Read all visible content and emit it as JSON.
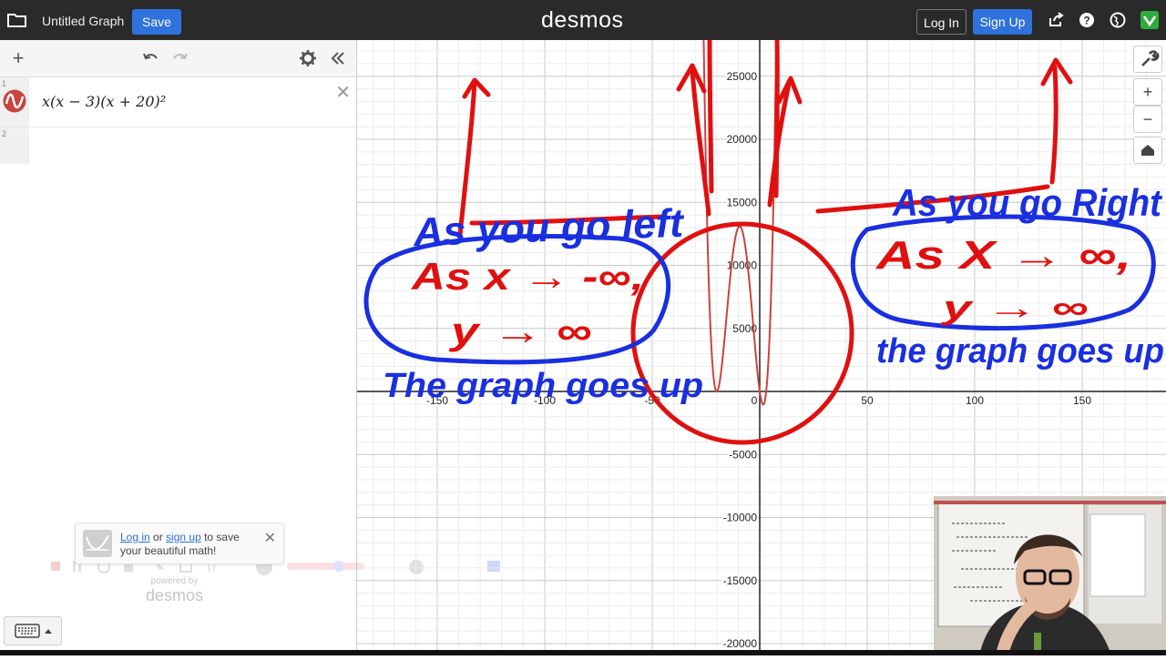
{
  "header": {
    "title": "Untitled Graph",
    "save_label": "Save",
    "brand": "desmos",
    "login_label": "Log In",
    "signup_label": "Sign Up",
    "icons": [
      "folder-icon",
      "share-icon",
      "help-icon",
      "globe-icon",
      "avatar-icon"
    ]
  },
  "expressions": [
    {
      "index": "1",
      "latex": "x(x − 3)(x + 20)²",
      "color": "#c74440"
    },
    {
      "index": "2",
      "latex": ""
    }
  ],
  "toast": {
    "login_link": "Log in",
    "or_text": " or ",
    "signup_link": "sign up",
    "message": " to save your beautiful math!"
  },
  "powered": {
    "label": "powered by",
    "brand": "desmos"
  },
  "graph": {
    "x_ticks": [
      "-150",
      "-100",
      "-50",
      "0",
      "50",
      "100",
      "150"
    ],
    "y_ticks": [
      "25000",
      "20000",
      "15000",
      "10000",
      "5000",
      "-5000",
      "-10000",
      "-15000",
      "-20000"
    ],
    "curve_color": "#c74440"
  },
  "annotations": {
    "left_heading": "As you go left",
    "left_limit_x": "As x → -∞,",
    "left_limit_y": "y → ∞",
    "left_caption": "The graph goes up",
    "right_heading": "As you go Right",
    "right_limit_x": "As X → ∞,",
    "right_limit_y": "y → ∞",
    "right_caption": "the graph goes up"
  },
  "colors": {
    "accent": "#2f72dc",
    "topbar": "#2a2a2a",
    "ink_red": "#e01010",
    "ink_blue": "#1a2fe0"
  }
}
